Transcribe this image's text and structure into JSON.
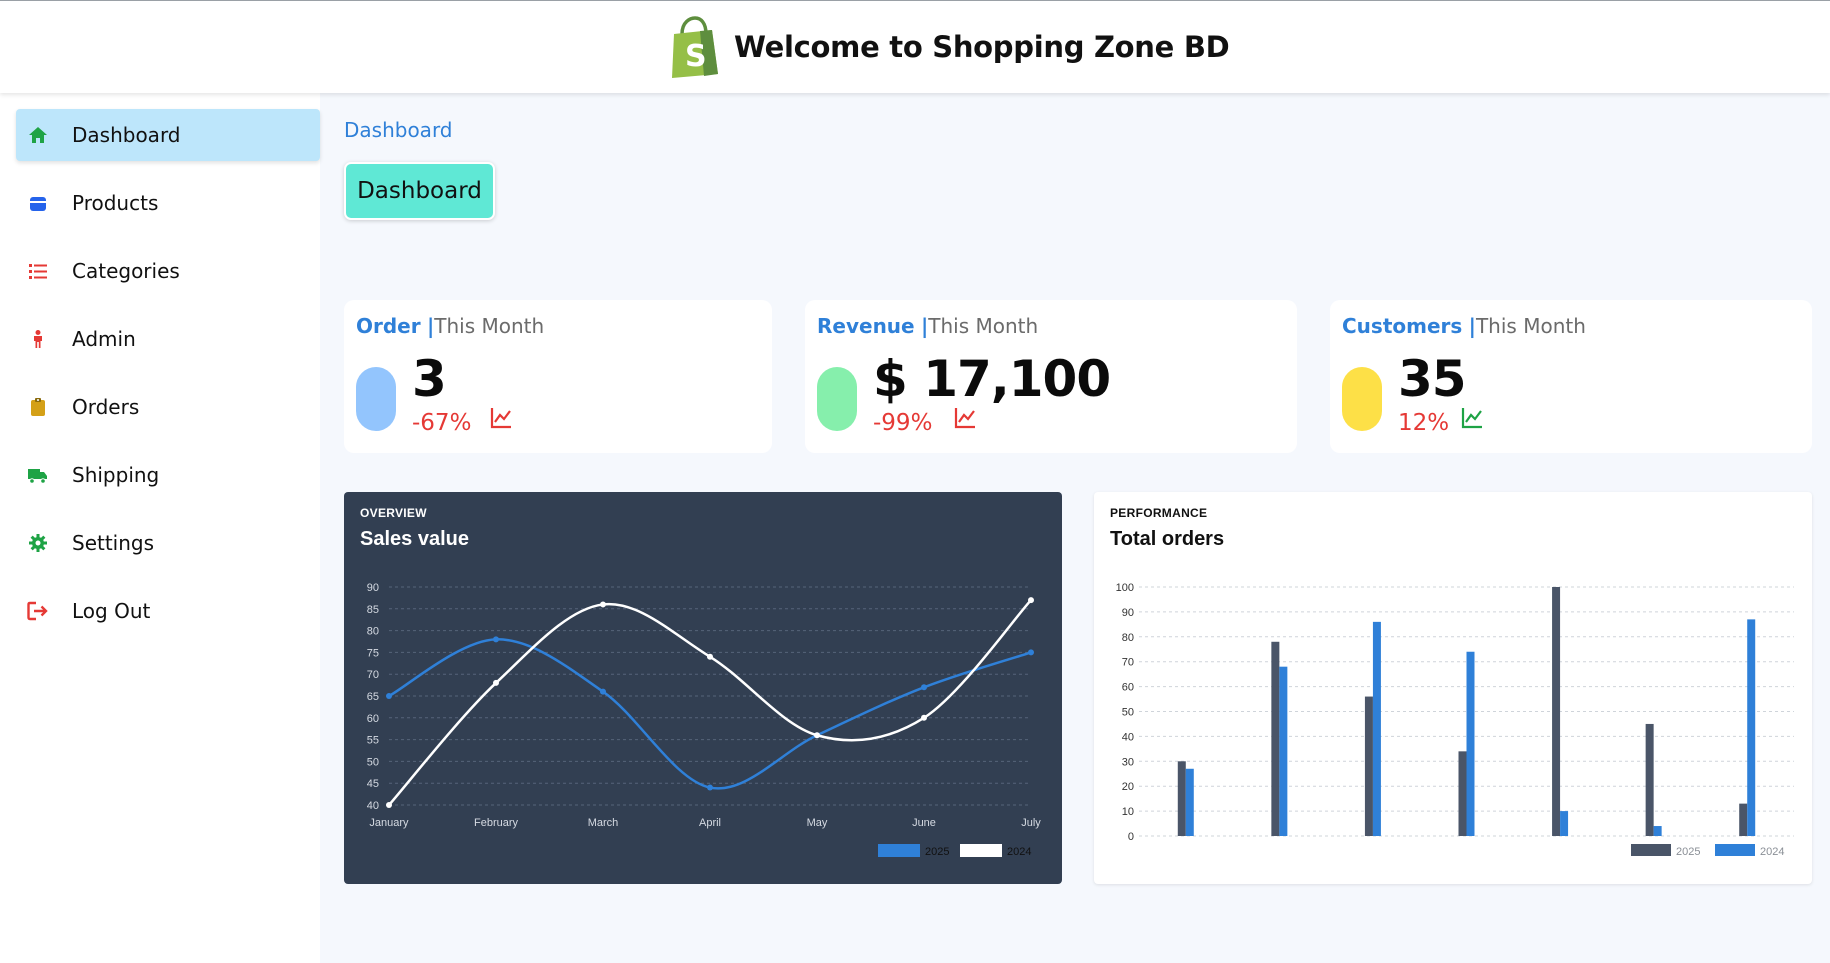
{
  "header": {
    "title": "Welcome to Shopping Zone BD",
    "logo_icon": "shopify-bag-icon",
    "logo_letter": "S"
  },
  "sidebar": {
    "items": [
      {
        "label": "Dashboard",
        "icon": "home-icon",
        "color": "#1ea345",
        "active": true
      },
      {
        "label": "Products",
        "icon": "box-icon",
        "color": "#2563eb",
        "active": false
      },
      {
        "label": "Categories",
        "icon": "list-icon",
        "color": "#e53935",
        "active": false
      },
      {
        "label": "Admin",
        "icon": "person-icon",
        "color": "#e53935",
        "active": false
      },
      {
        "label": "Orders",
        "icon": "clipboard-icon",
        "color": "#d4a017",
        "active": false
      },
      {
        "label": "Shipping",
        "icon": "truck-icon",
        "color": "#1ea345",
        "active": false
      },
      {
        "label": "Settings",
        "icon": "gear-icon",
        "color": "#1ea345",
        "active": false
      },
      {
        "label": "Log Out",
        "icon": "logout-icon",
        "color": "#e53935",
        "active": false
      }
    ]
  },
  "breadcrumb": "Dashboard",
  "page_button": "Dashboard",
  "cards": [
    {
      "key": "Order",
      "separator": "|",
      "period": "This Month",
      "value": "3",
      "change": "-67%",
      "pill_color": "#93c5fd",
      "trend_color": "#e53935"
    },
    {
      "key": "Revenue",
      "separator": "|",
      "period": "This Month",
      "value": "$ 17,100",
      "change": "-99%",
      "pill_color": "#86efac",
      "trend_color": "#e53935"
    },
    {
      "key": "Customers",
      "separator": "|",
      "period": "This Month",
      "value": "35",
      "change": "12%",
      "pill_color": "#fde047",
      "trend_color": "#1ea345"
    }
  ],
  "chart_data": [
    {
      "type": "line",
      "eyebrow": "OVERVIEW",
      "title": "Sales value",
      "categories": [
        "January",
        "February",
        "March",
        "April",
        "May",
        "June",
        "July"
      ],
      "series": [
        {
          "name": "2025",
          "color": "#2f80d8",
          "values": [
            65,
            78,
            66,
            44,
            56,
            67,
            75
          ]
        },
        {
          "name": "2024",
          "color": "#ffffff",
          "values": [
            40,
            68,
            86,
            74,
            56,
            60,
            87
          ]
        }
      ],
      "ylim": [
        40,
        90
      ],
      "yticks": [
        40,
        45,
        50,
        55,
        60,
        65,
        70,
        75,
        80,
        85,
        90
      ],
      "grid": true,
      "legend": "bottom-right"
    },
    {
      "type": "bar",
      "eyebrow": "PERFORMANCE",
      "title": "Total orders",
      "categories": [
        "",
        "",
        "",
        "",
        "",
        "",
        ""
      ],
      "series": [
        {
          "name": "2025",
          "color": "#4a5568",
          "values": [
            30,
            78,
            56,
            34,
            100,
            45,
            13
          ]
        },
        {
          "name": "2024",
          "color": "#2f80d8",
          "values": [
            27,
            68,
            86,
            74,
            10,
            4,
            87
          ]
        }
      ],
      "ylim": [
        0,
        100
      ],
      "yticks": [
        0,
        10,
        20,
        30,
        40,
        50,
        60,
        70,
        80,
        90,
        100
      ],
      "grid": true,
      "legend": "bottom-right"
    }
  ]
}
